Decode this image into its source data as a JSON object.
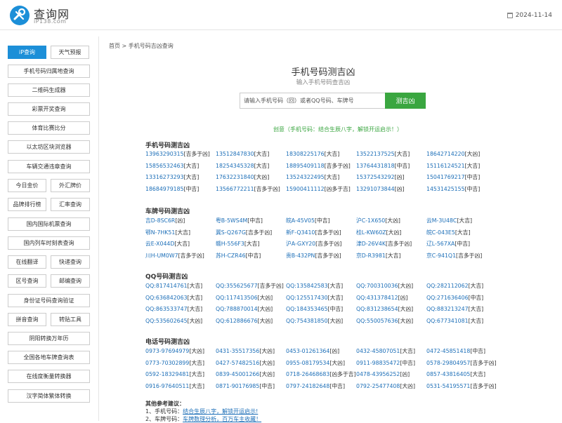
{
  "header": {
    "logo_title": "查询网",
    "logo_sub": "iP138.com",
    "date": "2024-11-14"
  },
  "sidebar": [
    {
      "label": "iP查询",
      "active": true
    },
    {
      "label": "天气预报"
    },
    {
      "label": "手机号码归属地查询"
    },
    {
      "label": "二维码生成器"
    },
    {
      "label": "彩票开奖查询"
    },
    {
      "label": "体育比赛比分"
    },
    {
      "label": "以太坊区块浏览器"
    },
    {
      "label": "车辆交通违章查询"
    },
    {
      "label": "今日金价"
    },
    {
      "label": "外汇牌价"
    },
    {
      "label": "品牌排行榜"
    },
    {
      "label": "汇率查询"
    },
    {
      "label": "国内国际机票查询"
    },
    {
      "label": "国内列车时刻表查询"
    },
    {
      "label": "在线翻译"
    },
    {
      "label": "快递查询"
    },
    {
      "label": "区号查询"
    },
    {
      "label": "邮编查询"
    },
    {
      "label": "身份证号码查询验证"
    },
    {
      "label": "拼音查询"
    },
    {
      "label": "转贴工具"
    },
    {
      "label": "阴阳转换万年历"
    },
    {
      "label": "全国各地车牌查询表"
    },
    {
      "label": "在线度衡量转换器"
    },
    {
      "label": "汉字简体繁体转换"
    }
  ],
  "breadcrumb": "首页 > 手机号码吉凶查询",
  "main": {
    "title": "手机号码测吉凶",
    "subtitle": "输入手机号码查吉凶",
    "search_placeholder": "请输入手机号码（回）或者QQ号码、车牌号",
    "search_button": "测吉凶",
    "tip": "创意（手机号码：结合生辰八字，解锁开运启示！）"
  },
  "sections": [
    {
      "title": "手机号码测吉凶",
      "items": [
        [
          "13963290315",
          "[吉多于凶]"
        ],
        [
          "13512847830",
          "[大吉]"
        ],
        [
          "18308225176",
          "[大吉]"
        ],
        [
          "13522137525",
          "[大吉]"
        ],
        [
          "18642714220",
          "[大凶]"
        ],
        [
          "15856532463",
          "[大吉]"
        ],
        [
          "18254345328",
          "[大吉]"
        ],
        [
          "18895409118",
          "[吉多于凶]"
        ],
        [
          "13764431818",
          "[中吉]"
        ],
        [
          "15116124521",
          "[大吉]"
        ],
        [
          "13316273293",
          "[大吉]"
        ],
        [
          "17632231840",
          "[大凶]"
        ],
        [
          "13524322495",
          "[大吉]"
        ],
        [
          "15372543292",
          "[凶]"
        ],
        [
          "15041769217",
          "[中吉]"
        ],
        [
          "18684979185",
          "[中吉]"
        ],
        [
          "13566772211",
          "[吉多于凶]"
        ],
        [
          "15900411112",
          "[凶多于吉]"
        ],
        [
          "13291073844",
          "[凶]"
        ],
        [
          "14531425155",
          "[中吉]"
        ]
      ]
    },
    {
      "title": "车牌号码测吉凶",
      "items": [
        [
          "吉D-8SC6R",
          "[凶]"
        ],
        [
          "粤B-5WS4M",
          "[中吉]"
        ],
        [
          "皖A-45V05",
          "[中吉]"
        ],
        [
          "沪C-1X650",
          "[大凶]"
        ],
        [
          "云M-3U48C",
          "[大吉]"
        ],
        [
          "鄂N-7HK51",
          "[大吉]"
        ],
        [
          "冀S-Q267G",
          "[吉多于凶]"
        ],
        [
          "新F-Q3410",
          "[吉多于凶]"
        ],
        [
          "桂L-KW60Z",
          "[大凶]"
        ],
        [
          "皖C-043E5",
          "[大吉]"
        ],
        [
          "云E-X044D",
          "[大吉]"
        ],
        [
          "赣H-556F3",
          "[大吉]"
        ],
        [
          "沪A-GXY20",
          "[吉多于凶]"
        ],
        [
          "津D-26V4K",
          "[吉多于凶]"
        ],
        [
          "辽L-567XA",
          "[中吉]"
        ],
        [
          "川H-UM0W7",
          "[吉多于凶]"
        ],
        [
          "苏H-CZR46",
          "[中吉]"
        ],
        [
          "贵B-432PN",
          "[吉多于凶]"
        ],
        [
          "京D-R3981",
          "[大吉]"
        ],
        [
          "京C-941Q1",
          "[吉多于凶]"
        ]
      ]
    },
    {
      "title": "QQ号码测吉凶",
      "items": [
        [
          "QQ:817414761",
          "[大吉]"
        ],
        [
          "QQ:355625677",
          "[吉多于凶]"
        ],
        [
          "QQ:135842583",
          "[大吉]"
        ],
        [
          "QQ:700310036",
          "[大凶]"
        ],
        [
          "QQ:282112062",
          "[大吉]"
        ],
        [
          "QQ:636842063",
          "[大吉]"
        ],
        [
          "QQ:117413506",
          "[大凶]"
        ],
        [
          "QQ:125517430",
          "[大吉]"
        ],
        [
          "QQ:431378412",
          "[凶]"
        ],
        [
          "QQ:271636406",
          "[中吉]"
        ],
        [
          "QQ:863533747",
          "[大吉]"
        ],
        [
          "QQ:788870014",
          "[大凶]"
        ],
        [
          "QQ:184353465",
          "[中吉]"
        ],
        [
          "QQ:831238654",
          "[大凶]"
        ],
        [
          "QQ:883213247",
          "[大吉]"
        ],
        [
          "QQ:535602645",
          "[大凶]"
        ],
        [
          "QQ:612886676",
          "[大凶]"
        ],
        [
          "QQ:754381850",
          "[大凶]"
        ],
        [
          "QQ:550057636",
          "[大凶]"
        ],
        [
          "QQ:677341081",
          "[大吉]"
        ]
      ]
    },
    {
      "title": "电话号码测吉凶",
      "items": [
        [
          "0973-97694979",
          "[大凶]"
        ],
        [
          "0431-35517356",
          "[大凶]"
        ],
        [
          "0453-01261364",
          "[凶]"
        ],
        [
          "0432-45807051",
          "[大吉]"
        ],
        [
          "0472-45851418",
          "[中吉]"
        ],
        [
          "0773-70302899",
          "[大吉]"
        ],
        [
          "0427-57482516",
          "[大凶]"
        ],
        [
          "0955-08179534",
          "[大凶]"
        ],
        [
          "0911-98835472",
          "[中吉]"
        ],
        [
          "0578-29804957",
          "[吉多于凶]"
        ],
        [
          "0592-18329481",
          "[大吉]"
        ],
        [
          "0839-45001266",
          "[大凶]"
        ],
        [
          "0718-26468683",
          "[凶多于吉]"
        ],
        [
          "0478-43956252",
          "[凶]"
        ],
        [
          "0857-43816405",
          "[大吉]"
        ],
        [
          "0916-97640511",
          "[大吉]"
        ],
        [
          "0871-90176985",
          "[中吉]"
        ],
        [
          "0797-24182648",
          "[中吉]"
        ],
        [
          "0792-25477408",
          "[大凶]"
        ],
        [
          "0531-54195571",
          "[吉多于凶]"
        ]
      ]
    }
  ],
  "notes": {
    "title": "其他参考建议：",
    "items": [
      {
        "prefix": "1、手机号码：",
        "link": "结合生辰八字，解锁开运启示!"
      },
      {
        "prefix": "2、车牌号码：",
        "link": "车牌数理分析，百万车主收藏！"
      }
    ]
  },
  "colors": {
    "accent": "#1c8fd8",
    "button_green": "#3aa640",
    "link": "#1d6fb8"
  }
}
